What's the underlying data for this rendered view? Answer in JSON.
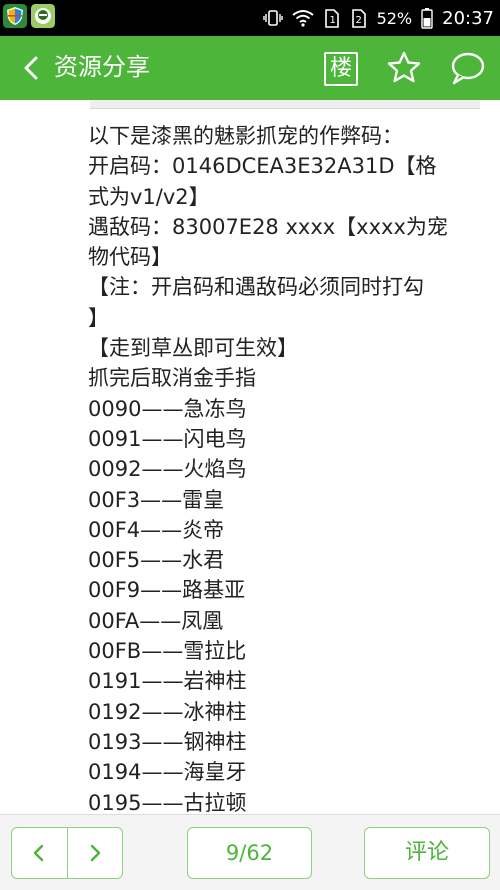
{
  "status_bar": {
    "battery_percent": "52%",
    "time": "20:37"
  },
  "header": {
    "title": "资源分享",
    "floor_label": "楼"
  },
  "post": {
    "lines": [
      "以下是漆黑的魅影抓宠的作弊码：",
      "开启码：0146DCEA3E32A31D【格",
      "式为v1/v2】",
      "遇敌码：83007E28 xxxx【xxxx为宠",
      "物代码】",
      "【注：开启码和遇敌码必须同时打勾",
      "】",
      "【走到草丛即可生效】",
      "抓完后取消金手指",
      "0090——急冻鸟",
      "0091——闪电鸟",
      "0092——火焰鸟",
      "00F3——雷皇",
      "00F4——炎帝",
      "00F5——水君",
      "00F9——路基亚",
      "00FA——凤凰",
      "00FB——雪拉比",
      "0191——岩神柱",
      "0192——冰神柱",
      "0193——钢神柱",
      "0194——海皇牙",
      "0195——古拉顿"
    ]
  },
  "bottom_bar": {
    "page_indicator": "9/62",
    "comment_label": "评论"
  },
  "colors": {
    "accent": "#4cb53a",
    "status_bar_bg": "#000000"
  }
}
